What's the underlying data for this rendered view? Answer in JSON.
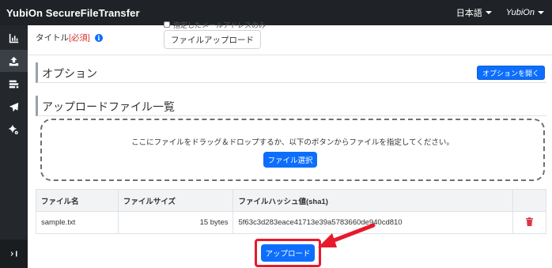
{
  "app": {
    "title": "YubiOn SecureFileTransfer"
  },
  "navbar": {
    "language": "日本語",
    "user": "YubiOn"
  },
  "sidebar": {
    "items": [
      {
        "icon": "chart-icon"
      },
      {
        "icon": "upload-icon",
        "active": true
      },
      {
        "icon": "file-list-icon"
      },
      {
        "icon": "send-icon"
      },
      {
        "icon": "settings-icon"
      }
    ],
    "collapse_label": "⇥"
  },
  "form": {
    "clipped_text": "指定したメールアドレスのみ",
    "title_label": "タイトル",
    "required_mark": "[必須]",
    "title_value": "ファイルアップロード",
    "info_glyph": "i"
  },
  "options_section": {
    "title": "オプション",
    "open_button": "オプションを開く"
  },
  "upload_section": {
    "title": "アップロードファイル一覧",
    "drop_text": "ここにファイルをドラッグ＆ドロップするか、以下のボタンからファイルを指定してください。",
    "select_button": "ファイル選択"
  },
  "file_table": {
    "headers": [
      "ファイル名",
      "ファイルサイズ",
      "ファイルハッシュ値(sha1)",
      ""
    ],
    "rows": [
      {
        "name": "sample.txt",
        "size": "15 bytes",
        "hash": "5f63c3d283eace41713e39a5783660de940cd810"
      }
    ]
  },
  "upload_button": "アップロード",
  "colors": {
    "primary": "#0d6efd",
    "navbar": "#1f2226",
    "sidebar": "#24282c",
    "highlight": "#e8192c",
    "danger": "#dc3545"
  }
}
